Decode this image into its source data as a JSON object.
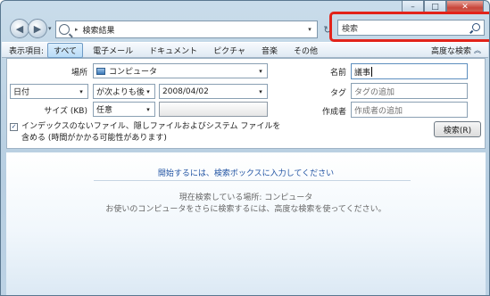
{
  "window": {
    "caption": {
      "minimize": "–",
      "maximize": "□",
      "close": "✕"
    }
  },
  "navigation": {
    "back_icon": "◀",
    "forward_icon": "▶",
    "history_dropdown": "▾",
    "address": {
      "separator": "▸",
      "path": "検索結果",
      "dropdown": "▾"
    },
    "refresh_icon": "↻",
    "search": {
      "placeholder": "検索",
      "highlight_color": "#e2231a"
    }
  },
  "filter_bar": {
    "label": "表示項目:",
    "tabs": [
      {
        "label": "すべて",
        "active": true
      },
      {
        "label": "電子メール"
      },
      {
        "label": "ドキュメント"
      },
      {
        "label": "ピクチャ"
      },
      {
        "label": "音楽"
      },
      {
        "label": "その他"
      }
    ],
    "advanced_label": "高度な検索",
    "advanced_chevron": "︽"
  },
  "advanced_search": {
    "location_label": "場所",
    "location_value": "コンピュータ",
    "date_field": "日付",
    "date_condition": "が次よりも後",
    "date_value": "2008/04/02",
    "size_label": "サイズ (KB)",
    "size_value": "任意",
    "name_label": "名前",
    "name_value": "議事",
    "tag_label": "タグ",
    "tag_placeholder": "タグの追加",
    "author_label": "作成者",
    "author_placeholder": "作成者の追加",
    "include_nonindexed": {
      "checked": true,
      "check_mark": "✓",
      "label": "インデックスのないファイル、隠しファイルおよびシステム ファイルを含める (時間がかかる可能性があります)"
    },
    "search_button": "検索(R)",
    "dropdown_arrow": "▾"
  },
  "results": {
    "hint": "開始するには、検索ボックスに入力してください",
    "scope": "現在検索している場所: コンピュータ",
    "more": "お使いのコンピュータをさらに検索するには、高度な検索を使ってください。"
  }
}
